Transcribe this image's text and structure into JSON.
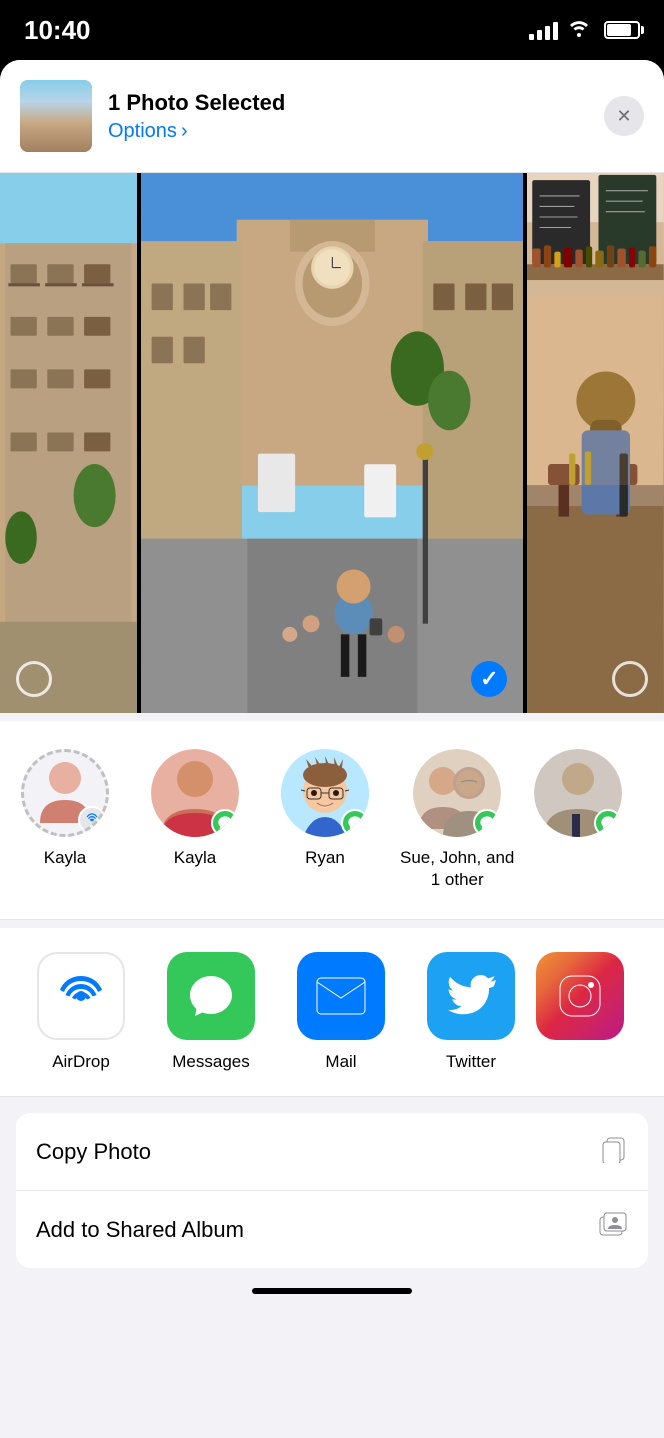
{
  "statusBar": {
    "time": "10:40",
    "batteryLevel": 75
  },
  "shareHeader": {
    "title": "1 Photo Selected",
    "optionsLabel": "Options",
    "optionsChevron": "›",
    "closeAriaLabel": "Close",
    "closeSymbol": "✕"
  },
  "contacts": [
    {
      "name": "Kayla",
      "type": "airdrop",
      "badge": "airdrop"
    },
    {
      "name": "Kayla",
      "type": "messages",
      "badge": "messages"
    },
    {
      "name": "Ryan",
      "type": "memoji",
      "badge": "messages"
    },
    {
      "name": "Sue, John, and 1 other",
      "type": "group",
      "badge": "messages"
    },
    {
      "name": "",
      "type": "partial",
      "badge": "messages"
    }
  ],
  "apps": [
    {
      "name": "AirDrop",
      "type": "airdrop"
    },
    {
      "name": "Messages",
      "type": "messages"
    },
    {
      "name": "Mail",
      "type": "mail"
    },
    {
      "name": "Twitter",
      "type": "twitter"
    },
    {
      "name": "Ins...",
      "type": "instagram"
    }
  ],
  "actions": [
    {
      "label": "Copy Photo",
      "icon": "copy"
    },
    {
      "label": "Add to Shared Album",
      "icon": "album"
    }
  ],
  "photos": [
    {
      "alt": "Building with balconies",
      "selected": false,
      "showLeftCircle": true
    },
    {
      "alt": "Cathedral street",
      "selected": true,
      "showCheck": true
    },
    {
      "alt": "Restaurant interior",
      "selected": false,
      "showRightCircle": true
    }
  ]
}
